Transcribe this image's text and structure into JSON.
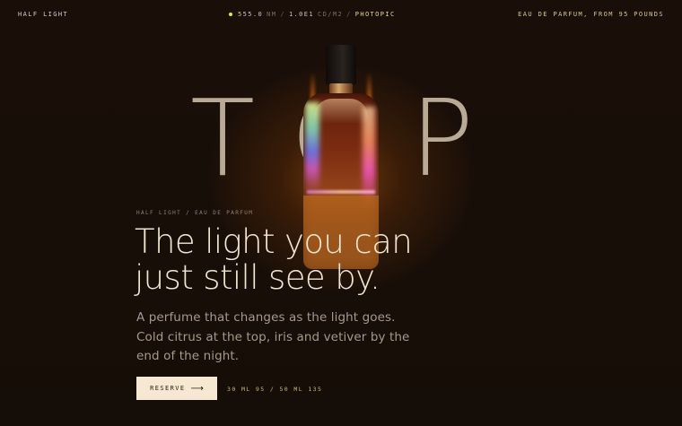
{
  "header": {
    "brand": "HALF LIGHT",
    "readout": {
      "wavelength": "555.0",
      "wavelength_unit": "NM",
      "separator": "/",
      "luminance": "1.0e1",
      "luminance_unit": "CD/M2",
      "mode": "PHOTOPIC"
    },
    "price_note": "EAU DE PARFUM, FROM 95 POUNDS"
  },
  "hero": {
    "big_word": "TOP",
    "eyebrow": "HALF LIGHT / EAU DE PARFUM",
    "headline_line1": "The light you can",
    "headline_line2": "just still see by.",
    "lede": "A perfume that changes as the light goes. Cold citrus at the top, iris and vetiver by the end of the night.",
    "cta_label": "RESERVE",
    "cta_arrow": "⟶",
    "sizes": "30 ML 95 / 50 ML 135"
  },
  "colors": {
    "background": "#170e07",
    "indicator_dot": "#dfe84a",
    "accent_text": "#d6c68a",
    "cta_background": "#f6e8d2"
  }
}
